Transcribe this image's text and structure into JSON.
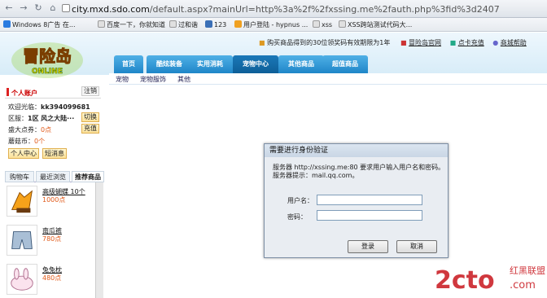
{
  "browser": {
    "url_prefix": "city.mxd.sdo.com",
    "url_rest": "/default.aspx?mainUrl=http%3a%2f%2fxssing.me%2fauth.php%3fid%3d2407",
    "bookmarks": [
      {
        "label": "Windows 8广告 在..."
      },
      {
        "label": "百度一下，你就知道"
      },
      {
        "label": "过和谐"
      },
      {
        "label": "123"
      },
      {
        "label": "用户登陆 - hypnus ..."
      },
      {
        "label": "xss"
      },
      {
        "label": "XSS跨站测试代码大..."
      }
    ]
  },
  "header": {
    "notice": "购买商品得到的30位领奖码有效期限为1年",
    "link_points": "冒险岛官网",
    "link_recharge": "点卡充值",
    "link_help": "商城帮助",
    "logo_text": "冒险岛",
    "logo_sub": "ONLINE"
  },
  "nav": {
    "tabs": [
      "首页",
      "酷炫装备",
      "实用消耗",
      "宠物中心",
      "其他商品",
      "超值商品"
    ],
    "active_index": 3,
    "subnav": [
      "宠物",
      "宠物服饰",
      "其他"
    ]
  },
  "account": {
    "title": "个人账户",
    "logout": "注销",
    "welcome_label": "欢迎光临：",
    "username": "kk394099681",
    "zone_label": "区服：",
    "zone_value": "1区",
    "server": "风之大陆···",
    "switch": "切换",
    "points_label": "盛大点券：",
    "points_value": "0点",
    "recharge": "充值",
    "mushroom_label": "蘑菇币：",
    "mushroom_value": "0个",
    "personal_center": "个人中心",
    "messages": "短消息"
  },
  "product_tabs": [
    "购物车",
    "最近浏览",
    "推荐商品"
  ],
  "products": [
    {
      "name": "高级蝴蝶 10个",
      "price": "1000点"
    },
    {
      "name": "南瓜裤",
      "price": "780点"
    },
    {
      "name": "兔兔枕",
      "price": "480点"
    }
  ],
  "dialog": {
    "title": "需要进行身份验证",
    "message_line1": "服务器 http://xssing.me:80 要求用户输入用户名和密码。",
    "message_line2": "服务器提示：mail.qq.com。",
    "username_label": "用户名：",
    "password_label": "密码：",
    "login": "登录",
    "cancel": "取消"
  },
  "watermark": {
    "brand": "2cto",
    "suffix": ".com",
    "tag": "红黑联盟"
  },
  "colors": {
    "nav_tab": "#1f86c8",
    "nav_active": "#0e5f98",
    "price": "#e05a1a",
    "watermark": "#c8161d"
  }
}
